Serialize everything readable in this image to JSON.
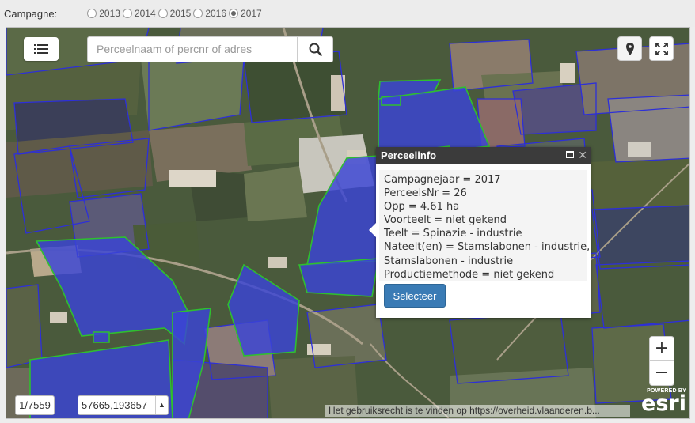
{
  "campagne": {
    "label": "Campagne:",
    "options": [
      {
        "year": "2013",
        "checked": false
      },
      {
        "year": "2014",
        "checked": false
      },
      {
        "year": "2015",
        "checked": false
      },
      {
        "year": "2016",
        "checked": false
      },
      {
        "year": "2017",
        "checked": true
      }
    ]
  },
  "toolbar": {
    "list_icon": "list-icon",
    "search_placeholder": "Perceelnaam of percnr of adres",
    "search_icon": "search-icon",
    "locate_icon": "map-marker-icon",
    "fullscreen_icon": "fullscreen-icon"
  },
  "popup": {
    "title": "Perceelinfo",
    "lines": [
      "Campagnejaar = 2017",
      "PerceelsNr = 26",
      "Opp = 4.61 ha",
      "Voorteelt = niet gekend",
      "Teelt = Spinazie - industrie",
      "Nateelt(en) = Stamslabonen - industrie,",
      "Stamslabonen - industrie",
      "Productiemethode = niet gekend"
    ],
    "select_label": "Selecteer",
    "close_symbol": "✕"
  },
  "zoom": {
    "in_label": "+",
    "out_label": "−"
  },
  "scale_text": "1/7559",
  "coordinates": "57665,193657",
  "attribution": "Het gebruiksrecht is te vinden op https://overheid.vlaanderen.b...",
  "logo": {
    "powered_by": "POWERED BY",
    "name": "esri"
  },
  "colors": {
    "selected_fill": "#3a44d6",
    "selected_stroke": "#2fbf2f",
    "parcel_stroke": "#2d2fd8",
    "button": "#3a7bb5"
  }
}
